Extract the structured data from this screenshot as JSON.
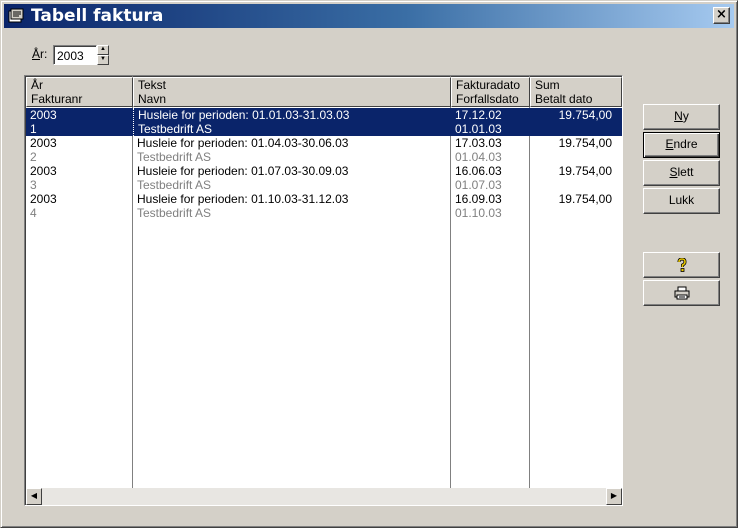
{
  "window": {
    "title": "Tabell faktura",
    "close_label": "×"
  },
  "year_field": {
    "label_access": "Å",
    "label_rest": "r:",
    "value": "2003"
  },
  "table": {
    "headers": [
      {
        "line1": "År",
        "line2": "Fakturanr"
      },
      {
        "line1": "Tekst",
        "line2": "Navn"
      },
      {
        "line1": "Fakturadato",
        "line2": "Forfallsdato"
      },
      {
        "line1": "Sum",
        "line2": "Betalt dato"
      }
    ],
    "rows": [
      {
        "year": "2003",
        "invoice_no": "1",
        "text": "Husleie for perioden: 01.01.03-31.03.03",
        "name": "Testbedrift AS",
        "invoice_date": "17.12.02",
        "due_date": "01.01.03",
        "sum": "19.754,00",
        "paid_date": "",
        "selected": true
      },
      {
        "year": "2003",
        "invoice_no": "2",
        "text": "Husleie for perioden: 01.04.03-30.06.03",
        "name": "Testbedrift AS",
        "invoice_date": "17.03.03",
        "due_date": "01.04.03",
        "sum": "19.754,00",
        "paid_date": "",
        "selected": false
      },
      {
        "year": "2003",
        "invoice_no": "3",
        "text": "Husleie for perioden: 01.07.03-30.09.03",
        "name": "Testbedrift AS",
        "invoice_date": "16.06.03",
        "due_date": "01.07.03",
        "sum": "19.754,00",
        "paid_date": "",
        "selected": false
      },
      {
        "year": "2003",
        "invoice_no": "4",
        "text": "Husleie for perioden: 01.10.03-31.12.03",
        "name": "Testbedrift AS",
        "invoice_date": "16.09.03",
        "due_date": "01.10.03",
        "sum": "19.754,00",
        "paid_date": "",
        "selected": false
      }
    ]
  },
  "buttons": {
    "new": {
      "access": "N",
      "rest": "y"
    },
    "edit": {
      "access": "E",
      "rest": "ndre"
    },
    "delete": {
      "access": "S",
      "rest": "lett"
    },
    "close": {
      "label": "Lukk"
    },
    "help_icon": "question-mark-icon",
    "print_icon": "printer-icon"
  },
  "colors": {
    "selection": "#0a246a",
    "title_start": "#0a246a",
    "title_end": "#a6caf0",
    "face": "#d4d0c8",
    "help_icon": "#e8c800"
  }
}
